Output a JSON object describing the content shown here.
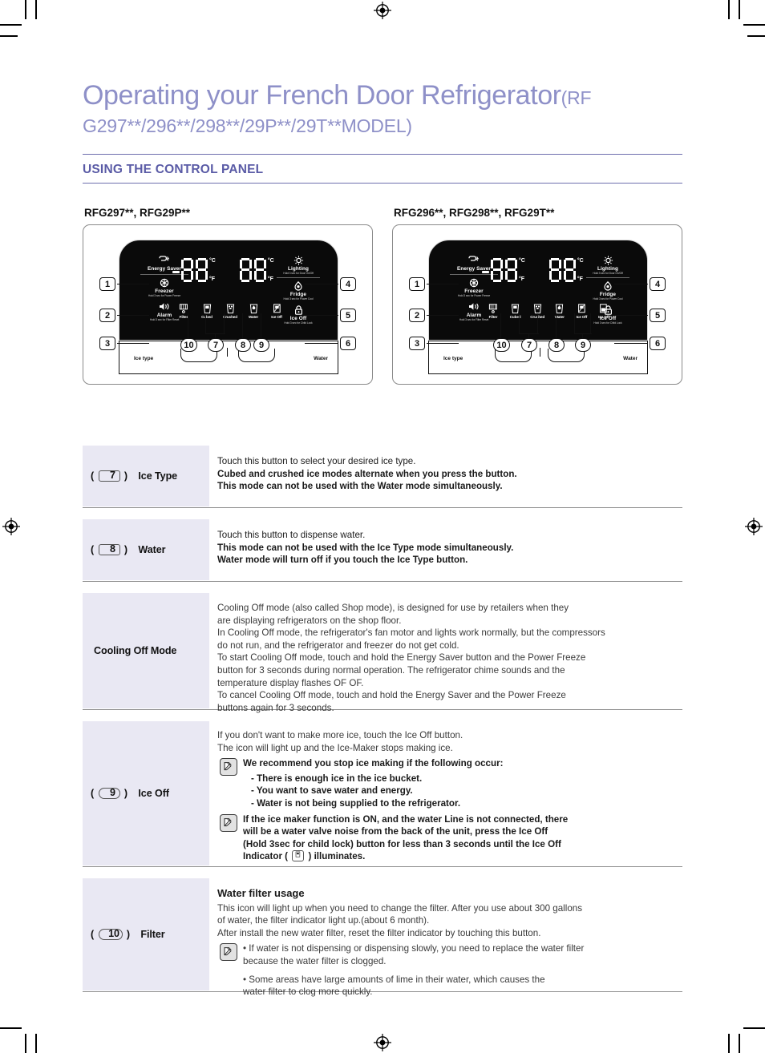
{
  "doc": {
    "title_main": "Operating your French Door Refrigerator",
    "title_main_suffix": "(RF",
    "title_second_line": "G297**/296**/298**/29P**/29T**MODEL)",
    "section_heading": "USING THE CONTROL PANEL",
    "heading_color": "#5a5ba6",
    "title_color": "#8e90c8"
  },
  "panels": [
    {
      "caption": "RFG297**, RFG29P**",
      "left_items": [
        {
          "icon": "energy-saver-icon",
          "label": "Energy Saver",
          "sub": ""
        },
        {
          "icon": "power-freeze-icon",
          "label": "Freezer",
          "sub": "Hold 3 sec for Power Freeze"
        },
        {
          "icon": "alarm-speaker-icon",
          "label": "Alarm",
          "sub": "Hold 3 sec for Filter Reset"
        }
      ],
      "right_items": [
        {
          "icon": "lighting-bulb-icon",
          "label": "Lighting",
          "sub": "Hold 3 sec for Door On/Off"
        },
        {
          "icon": "power-cool-icon",
          "label": "Fridge",
          "sub": "Hold 3 sec for Power Cool"
        },
        {
          "icon": "child-lock-icon",
          "label": "Ice Off",
          "sub": "Hold 3 sec for Child Lock"
        }
      ],
      "indicator_icons": [
        {
          "icon": "filter-icon",
          "label": "Filter"
        },
        {
          "icon": "cubed-ice-icon",
          "label": "Cubed"
        },
        {
          "icon": "crushed-ice-icon",
          "label": "Crushed"
        },
        {
          "icon": "water-glass-icon",
          "label": "Water"
        },
        {
          "icon": "ice-off-icon",
          "label": "Ice Off"
        }
      ],
      "display_left_value": "-88",
      "display_right_value": "88",
      "unit_c": "°C",
      "unit_f": "°F",
      "dispenser_left_label": "Ice type",
      "dispenser_right_label": "Water",
      "callouts": [
        "1",
        "2",
        "3",
        "4",
        "5",
        "6",
        "10",
        "7",
        "8",
        "9"
      ]
    },
    {
      "caption": "RFG296**, RFG298**, RFG29T**",
      "left_items": [
        {
          "icon": "energy-saver-icon",
          "label": "Energy Saver",
          "sub": ""
        },
        {
          "icon": "power-freeze-icon",
          "label": "Freezer",
          "sub": "Hold 3 sec for Power Freeze"
        },
        {
          "icon": "alarm-speaker-icon",
          "label": "Alarm",
          "sub": "Hold 3 sec for Filter Reset"
        }
      ],
      "right_items": [
        {
          "icon": "lighting-bulb-icon",
          "label": "Lighting",
          "sub": "Hold 3 sec for Door On/Off"
        },
        {
          "icon": "power-cool-icon",
          "label": "Fridge",
          "sub": "Hold 3 sec for Power Cool"
        },
        {
          "icon": "child-lock-icon",
          "label": "Ice Off",
          "sub": "Hold 3 sec for Child Lock"
        }
      ],
      "indicator_icons": [
        {
          "icon": "filter-icon",
          "label": "Filter"
        },
        {
          "icon": "cubed-ice-icon",
          "label": "Cubed"
        },
        {
          "icon": "crushed-ice-icon",
          "label": "Crushed"
        },
        {
          "icon": "water-glass-icon",
          "label": "Water"
        },
        {
          "icon": "ice-off-icon",
          "label": "Ice Off"
        },
        {
          "icon": "ice-off-2-icon",
          "label": "Ice Off"
        }
      ],
      "display_left_value": "-88",
      "display_right_value": "88",
      "unit_c": "°C",
      "unit_f": "°F",
      "dispenser_left_label": "Ice type",
      "dispenser_right_label": "Water",
      "callouts": [
        "1",
        "2",
        "3",
        "4",
        "5",
        "6",
        "10",
        "7",
        "8",
        "9"
      ]
    }
  ],
  "table": {
    "row_ice_type": {
      "num": "7",
      "label": "Ice Type",
      "l1_regular": "Touch this ",
      "l1_bold": "button to select your desired ice type.",
      "l2": "Cubed and crushed ice modes alternate when you press the button.",
      "l3": "This mode can not be used with the Water mode simultaneously."
    },
    "row_water": {
      "num": "8",
      "label": "Water",
      "l1_regular": "Touch this ",
      "l1_bold": "button to dispense water.",
      "l2": "This mode can not be used with the Ice Type mode simultaneously.",
      "l3": "Water mode will turn off if you touch the Ice Type button."
    },
    "row_cooling_off": {
      "label": "Cooling Off Mode",
      "lines": [
        "Cooling Off mode (also called Shop mode), is designed for use by retailers when they",
        "are displaying refrigerators on the shop floor.",
        "In Cooling Off mode, the refrigerator's fan motor and lights work normally, but the compressors",
        "do not run, and the refrigerator and freezer do not get cold.",
        "To start Cooling Off mode, touch and hold the Energy Saver button and the Power Freeze",
        "button for 3 seconds during normal operation. The refrigerator chime sounds and the",
        "temperature display flashes OF OF.",
        "To cancel Cooling Off mode, touch and hold the Energy Saver and the Power Freeze",
        " buttons again for 3 seconds."
      ]
    },
    "row_ice_off": {
      "num": "9",
      "label": "Ice Off",
      "intro": [
        "If you don't want to make more ice, touch the Ice Off button.",
        "The icon will light up and the Ice-Maker stops making ice."
      ],
      "note1_head": "We recommend you stop ice making if the following occur:",
      "note1_items": [
        "- There is enough ice in the ice bucket.",
        "- You want to save water and energy.",
        "- Water is not being supplied to the refrigerator."
      ],
      "note2_lines": [
        "If the ice maker function is ON, and the water Line is not connected, there",
        "will be a water valve noise from the back of the unit, press the Ice Off",
        "(Hold 3sec for child lock) button for less than 3 seconds until the Ice Off"
      ],
      "note2_last_a": "Indicator ( ",
      "note2_last_b": " ) illuminates."
    },
    "row_filter": {
      "num": "10",
      "label": "Filter",
      "heading": "Water filter usage",
      "lines": [
        "This icon will light up when you need to change the filter. After you use about 300 gallons",
        "of water, the filter indicator light up.(about 6 month).",
        "After install the new water filter, reset the filter indicator by touching this button."
      ],
      "bullets": [
        "• If water is not dispensing or dispensing slowly, you need to replace the water filter",
        "   because the water filter is clogged.",
        "• Some areas have large amounts of lime in their water, which causes the",
        "   water filter to clog more quickly."
      ]
    }
  }
}
